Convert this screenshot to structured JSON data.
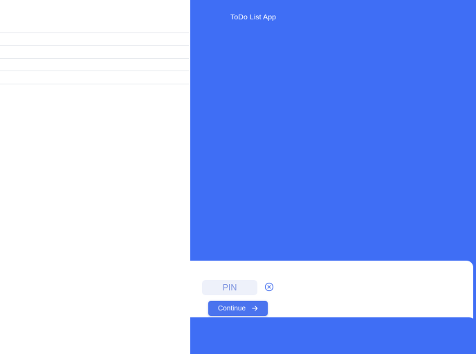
{
  "app": {
    "title": "ToDo List App"
  },
  "list": {
    "rows": [
      "",
      "",
      "",
      "",
      ""
    ]
  },
  "pin_form": {
    "pin_placeholder": "PIN",
    "pin_value": "",
    "continue_label": "Continue"
  },
  "icons": {
    "clear": "close-circle-icon",
    "continue_arrow": "arrow-right-icon"
  },
  "colors": {
    "accent_blue": "#3f6ef5",
    "button_blue": "#4a73ee",
    "input_bg": "#eef1fa",
    "input_text": "#7d93e0",
    "divider": "#e6e9ee"
  }
}
